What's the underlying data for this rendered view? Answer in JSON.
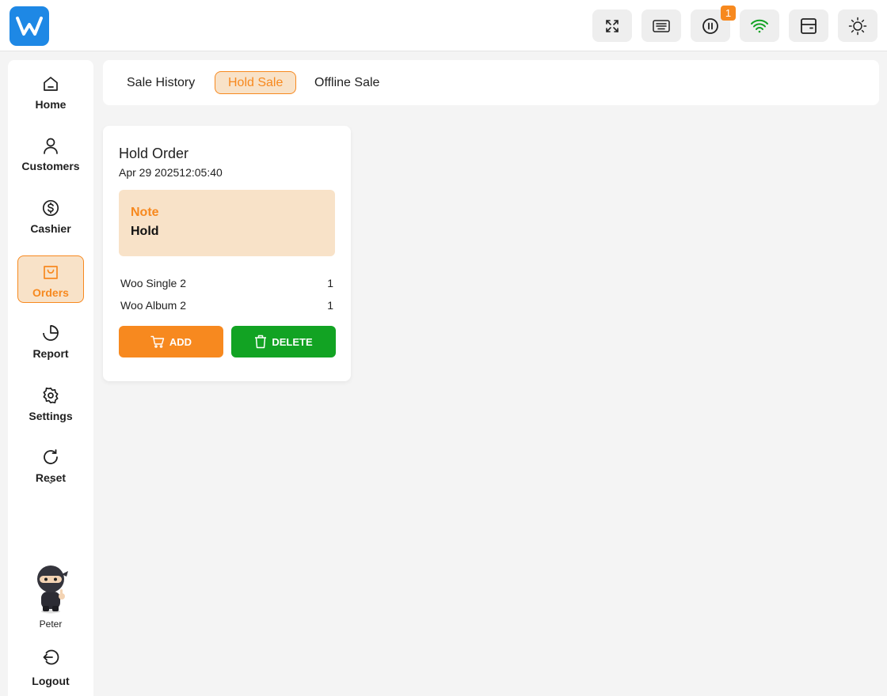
{
  "topbar": {
    "notification_count": "1",
    "buttons": [
      {
        "icon": "fullscreen-icon"
      },
      {
        "icon": "keyboard-icon"
      },
      {
        "icon": "pause-icon"
      },
      {
        "icon": "wifi-icon"
      },
      {
        "icon": "cash-drawer-icon"
      },
      {
        "icon": "sun-icon"
      }
    ]
  },
  "sidebar": {
    "items": [
      {
        "label": "Home",
        "icon": "home-icon"
      },
      {
        "label": "Customers",
        "icon": "user-icon"
      },
      {
        "label": "Cashier",
        "icon": "dollar-icon"
      },
      {
        "label": "Orders",
        "icon": "shopping-bag-icon",
        "active": true
      },
      {
        "label": "Report",
        "icon": "pie-chart-icon"
      },
      {
        "label": "Settings",
        "icon": "gear-icon"
      },
      {
        "label": "Reset",
        "icon": "refresh-icon"
      }
    ],
    "user_name": "Peter",
    "logout_label": "Logout"
  },
  "tabs": [
    {
      "label": "Sale History"
    },
    {
      "label": "Hold Sale",
      "active": true
    },
    {
      "label": "Offline Sale"
    }
  ],
  "hold_order": {
    "title": "Hold Order",
    "date": "Apr 29 202512:05:40",
    "note_label": "Note",
    "note_text": "Hold",
    "items": [
      {
        "name": "Woo Single 2",
        "qty": "1"
      },
      {
        "name": "Woo Album 2",
        "qty": "1"
      }
    ],
    "add_label": "ADD",
    "delete_label": "DELETE"
  },
  "colors": {
    "accent": "#f7891f",
    "accent_light": "#f8e2c8",
    "success": "#12a323",
    "wifi": "#12a323",
    "brand": "#1e88e5"
  }
}
